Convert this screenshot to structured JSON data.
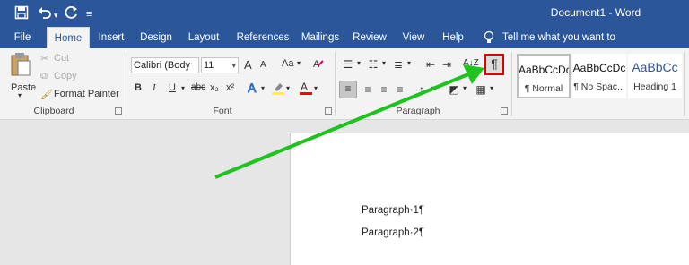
{
  "titlebar": {
    "title": "Document1  -  Word",
    "save_icon": "save-icon",
    "undo_icon": "undo-icon",
    "redo_icon": "redo-icon",
    "customize_icon": "customize-quick-access-icon"
  },
  "tabs": [
    "File",
    "Home",
    "Insert",
    "Design",
    "Layout",
    "References",
    "Mailings",
    "Review",
    "View",
    "Help"
  ],
  "active_tab": "Home",
  "tellme": "Tell me what you want to do",
  "clipboard": {
    "paste": "Paste",
    "cut": "Cut",
    "copy": "Copy",
    "format_painter": "Format Painter",
    "group": "Clipboard"
  },
  "font": {
    "name": "Calibri (Body",
    "size": "11",
    "group": "Font",
    "bold": "B",
    "italic": "I",
    "underline": "U",
    "strike": "abc",
    "subscript": "x₂",
    "superscript": "x²",
    "grow": "A",
    "shrink": "A",
    "case": "Aa",
    "highlight_color": "#ffff00",
    "font_color": "#ff0000"
  },
  "paragraph": {
    "group": "Paragraph",
    "show_hide": "¶",
    "sort": "A↓Z"
  },
  "styles": [
    {
      "sample": "AaBbCcDc",
      "name": "¶ Normal"
    },
    {
      "sample": "AaBbCcDc",
      "name": "¶ No Spac..."
    },
    {
      "sample": "AaBbCc",
      "name": "Heading 1"
    }
  ],
  "document": {
    "lines": [
      "Paragraph·1¶",
      "Paragraph·2¶"
    ]
  },
  "colors": {
    "word_blue": "#2b579a",
    "annotation_arrow": "#1fc31f",
    "highlight_box": "#dd0000"
  }
}
